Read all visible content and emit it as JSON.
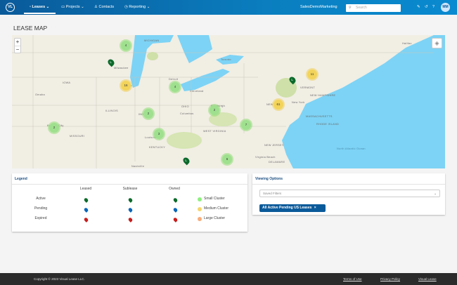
{
  "nav": {
    "logo": "VL",
    "items": [
      {
        "label": "Leases ⌄",
        "icon": "document-icon"
      },
      {
        "label": "Projects ⌄",
        "icon": "folder-icon"
      },
      {
        "label": "Contacts",
        "icon": "person-icon"
      },
      {
        "label": "Reporting ⌄",
        "icon": "chart-icon"
      }
    ],
    "account": "SalesDemoMarketing",
    "search_placeholder": "Search",
    "icons": [
      "wrench-icon",
      "history-icon",
      "help-icon"
    ],
    "avatar": "MM"
  },
  "page": {
    "title": "LEASE MAP"
  },
  "map": {
    "zoom_in": "+",
    "zoom_out": "−",
    "labels": [
      "MICHIGAN",
      "IOWA",
      "ILLINOIS",
      "INDIANA",
      "OHIO",
      "MISSOURI",
      "KENTUCKY",
      "WEST VIRGINIA",
      "NEW YORK",
      "VERMONT",
      "NEW HAMPSHIRE",
      "MASSACHUSETTS",
      "RHODE ISLAND",
      "NEW JERSEY",
      "DELAWARE",
      "North Atlantic Ocean",
      "Milwaukee",
      "Chicago",
      "Detroit",
      "Cleveland",
      "Columbus",
      "Toronto",
      "Omaha",
      "Kansas City",
      "Pittsburgh",
      "Nashville",
      "Louisville",
      "New York",
      "Halifax",
      "Virginia Beach"
    ],
    "clusters": [
      {
        "count": "4",
        "size": "small"
      },
      {
        "count": "16",
        "size": "medium"
      },
      {
        "count": "4",
        "size": "small"
      },
      {
        "count": "2",
        "size": "small"
      },
      {
        "count": "2",
        "size": "small"
      },
      {
        "count": "3",
        "size": "small"
      },
      {
        "count": "2",
        "size": "small"
      },
      {
        "count": "6",
        "size": "small"
      },
      {
        "count": "11",
        "size": "medium"
      },
      {
        "count": "61",
        "size": "medium"
      },
      {
        "count": "7",
        "size": "small"
      }
    ],
    "pins": [
      "L",
      "L",
      "L"
    ]
  },
  "legend": {
    "title": "Legend",
    "columns": [
      "Leased",
      "Sublease",
      "Owned"
    ],
    "rows": [
      "Active",
      "Pending",
      "Expired"
    ],
    "row_colors": [
      "#0b6a2a",
      "#0a66b8",
      "#c81e1e"
    ],
    "clusters": [
      {
        "label": "Small Cluster",
        "color": "#8ef07e"
      },
      {
        "label": "Medium Cluster",
        "color": "#f5d66b"
      },
      {
        "label": "Large Cluster",
        "color": "#f7ac7a"
      }
    ]
  },
  "viewing": {
    "title": "Viewing Options",
    "select_placeholder": "Saved Filters",
    "chip": "All Active Pending US Leases",
    "chip_close": "×"
  },
  "footer": {
    "copyright": "Copyright © 2023 Visual Lease LLC.",
    "links": [
      "Terms of Use",
      "Privacy Policy",
      "Visual Lease"
    ]
  }
}
